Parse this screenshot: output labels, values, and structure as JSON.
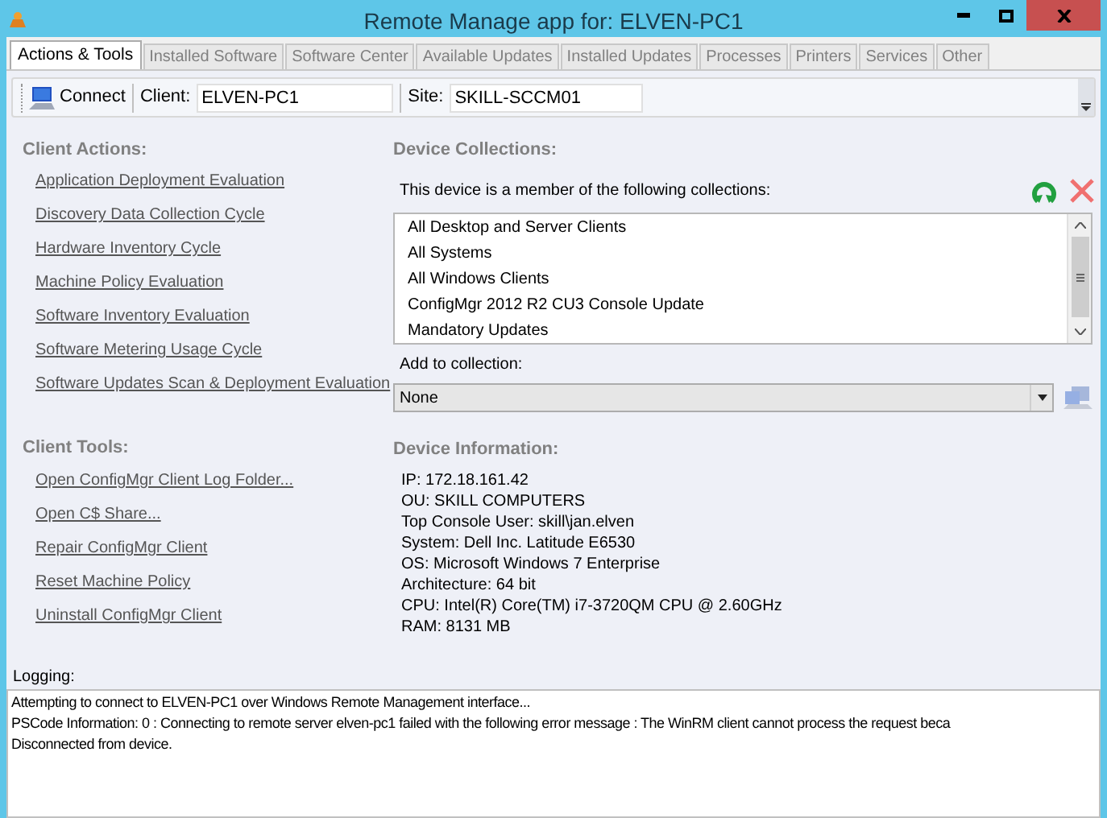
{
  "window": {
    "title": "Remote Manage app for: ELVEN-PC1"
  },
  "tabs": [
    {
      "label": "Actions & Tools",
      "selected": true
    },
    {
      "label": "Installed Software",
      "selected": false
    },
    {
      "label": "Software Center",
      "selected": false
    },
    {
      "label": "Available Updates",
      "selected": false
    },
    {
      "label": "Installed Updates",
      "selected": false
    },
    {
      "label": "Processes",
      "selected": false
    },
    {
      "label": "Printers",
      "selected": false
    },
    {
      "label": "Services",
      "selected": false
    },
    {
      "label": "Other",
      "selected": false
    }
  ],
  "toolbar": {
    "connect_label": "Connect",
    "client_label": "Client:",
    "client_value": "ELVEN-PC1",
    "site_label": "Site:",
    "site_value": "SKILL-SCCM01"
  },
  "client_actions": {
    "heading": "Client Actions:",
    "links": [
      "Application Deployment Evaluation",
      "Discovery Data Collection Cycle",
      "Hardware Inventory Cycle",
      "Machine Policy Evaluation",
      "Software Inventory Evaluation",
      "Software Metering Usage Cycle",
      "Software Updates Scan & Deployment Evaluation"
    ]
  },
  "device_collections": {
    "heading": "Device Collections:",
    "caption": "This device is a member of the following collections:",
    "items": [
      "All Desktop and Server Clients",
      "All Systems",
      "All Windows Clients",
      "ConfigMgr 2012 R2 CU3 Console Update",
      "Mandatory Updates"
    ],
    "add_label": "Add to collection:",
    "dropdown_value": "None"
  },
  "client_tools": {
    "heading": "Client Tools:",
    "links": [
      "Open ConfigMgr Client Log Folder...",
      "Open C$ Share...",
      "Repair ConfigMgr Client",
      "Reset Machine Policy",
      "Uninstall ConfigMgr Client"
    ]
  },
  "device_information": {
    "heading": "Device Information:",
    "lines": [
      "IP: 172.18.161.42",
      "OU: SKILL COMPUTERS",
      "Top Console User: skill\\jan.elven",
      "System: Dell Inc. Latitude E6530",
      "OS: Microsoft Windows 7 Enterprise",
      "Architecture: 64 bit",
      "CPU: Intel(R) Core(TM) i7-3720QM CPU @ 2.60GHz",
      "RAM: 8131 MB"
    ]
  },
  "logging": {
    "label": "Logging:",
    "lines": [
      "Attempting to connect to ELVEN-PC1 over Windows Remote Management interface...",
      "PSCode Information: 0 : Connecting to remote server elven-pc1 failed with the following error message : The WinRM client cannot process the request beca",
      "Disconnected from device."
    ]
  }
}
